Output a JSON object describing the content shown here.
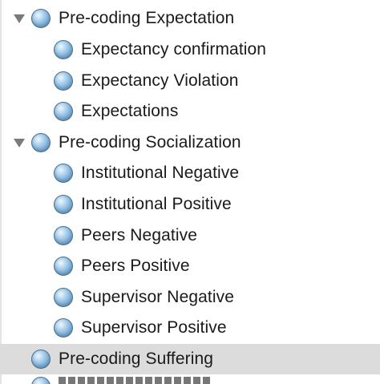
{
  "tree": {
    "groups": [
      {
        "label": "Pre-coding Expectation",
        "expanded": true,
        "icon": "code-node-icon",
        "children": [
          {
            "label": "Expectancy confirmation",
            "icon": "code-node-icon"
          },
          {
            "label": "Expectancy Violation",
            "icon": "code-node-icon"
          },
          {
            "label": "Expectations",
            "icon": "code-node-icon"
          }
        ]
      },
      {
        "label": "Pre-coding Socialization",
        "expanded": true,
        "icon": "code-node-icon",
        "children": [
          {
            "label": "Institutional Negative",
            "icon": "code-node-icon"
          },
          {
            "label": "Institutional Positive",
            "icon": "code-node-icon"
          },
          {
            "label": "Peers Negative",
            "icon": "code-node-icon"
          },
          {
            "label": "Peers Positive",
            "icon": "code-node-icon"
          },
          {
            "label": "Supervisor Negative",
            "icon": "code-node-icon"
          },
          {
            "label": "Supervisor Positive",
            "icon": "code-node-icon"
          }
        ]
      },
      {
        "label": "Pre-coding Suffering",
        "expanded": false,
        "selected": true,
        "icon": "code-node-icon",
        "children": []
      }
    ]
  },
  "colors": {
    "selected_row": "#dcdcdc",
    "node_icon": "#7fb0d8",
    "disclosure": "#7b7b7b",
    "text": "#1a1a1a"
  }
}
